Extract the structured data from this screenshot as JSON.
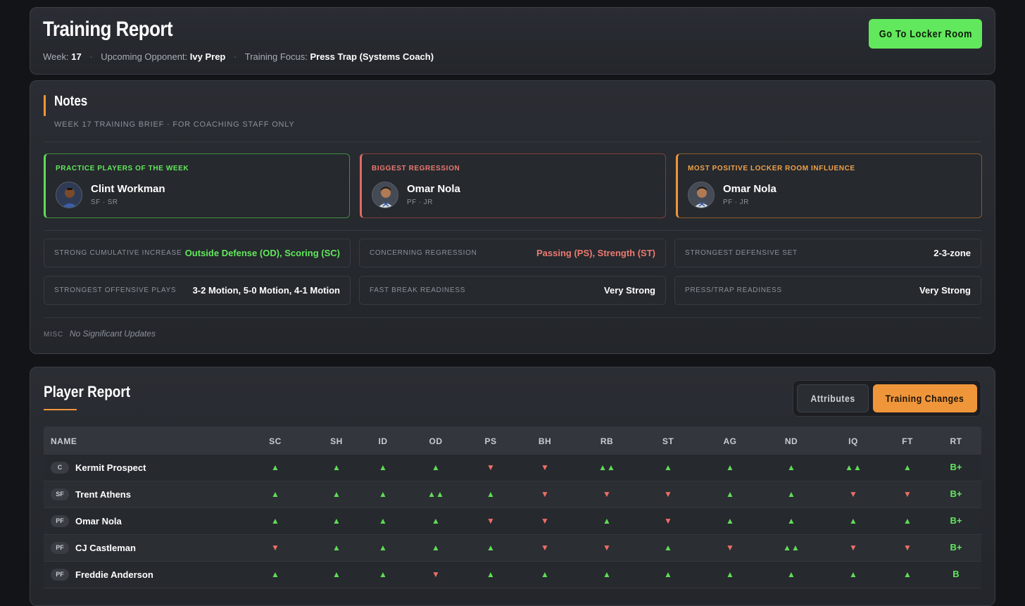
{
  "header": {
    "title": "Training Report",
    "week_label": "Week:",
    "week": "17",
    "opponent_label": "Upcoming Opponent:",
    "opponent": "Ivy Prep",
    "focus_label": "Training Focus:",
    "focus": "Press Trap (Systems Coach)",
    "locker_button": "Go To Locker Room"
  },
  "notes": {
    "title": "Notes",
    "subtitle": "WEEK 17 TRAINING BRIEF · FOR COACHING STAFF ONLY",
    "awards": [
      {
        "label": "PRACTICE PLAYERS OF THE WEEK",
        "name": "Clint Workman",
        "pos": "SF · SR",
        "accent": "#5fdc55"
      },
      {
        "label": "BIGGEST REGRESSION",
        "name": "Omar Nola",
        "pos": "PF · JR",
        "accent": "#e06b63"
      },
      {
        "label": "MOST POSITIVE LOCKER ROOM INFLUENCE",
        "name": "Omar Nola",
        "pos": "PF · JR",
        "accent": "#f0963a"
      }
    ],
    "stats": [
      {
        "label": "STRONG CUMULATIVE INCREASE",
        "value": "Outside Defense (OD), Scoring (SC)"
      },
      {
        "label": "CONCERNING REGRESSION",
        "value": "Passing (PS), Strength (ST)"
      },
      {
        "label": "STRONGEST DEFENSIVE SET",
        "value": "2-3-zone"
      },
      {
        "label": "STRONGEST OFFENSIVE PLAYS",
        "value": "3-2 Motion, 5-0 Motion, 4-1 Motion"
      },
      {
        "label": "FAST BREAK READINESS",
        "value": "Very Strong"
      },
      {
        "label": "PRESS/TRAP READINESS",
        "value": "Very Strong"
      }
    ],
    "misc_label": "MISC",
    "misc_value": "No Significant Updates"
  },
  "report": {
    "title": "Player Report",
    "tab_attributes": "Attributes",
    "tab_training": "Training Changes",
    "columns": [
      "NAME",
      "SC",
      "SH",
      "ID",
      "OD",
      "PS",
      "BH",
      "RB",
      "ST",
      "AG",
      "ND",
      "IQ",
      "FT",
      "RT"
    ],
    "rows": [
      {
        "pos": "C",
        "name": "Kermit Prospect",
        "changes": [
          "▲",
          "▲",
          "▲",
          "▲",
          "▼",
          "▼",
          "▲▲",
          "▲",
          "▲",
          "▲",
          "▲▲",
          "▲"
        ],
        "rt": "B+"
      },
      {
        "pos": "SF",
        "name": "Trent Athens",
        "changes": [
          "▲",
          "▲",
          "▲",
          "▲▲",
          "▲",
          "▼",
          "▼",
          "▼",
          "▲",
          "▲",
          "▼",
          "▼"
        ],
        "rt": "B+"
      },
      {
        "pos": "PF",
        "name": "Omar Nola",
        "changes": [
          "▲",
          "▲",
          "▲",
          "▲",
          "▼",
          "▼",
          "▲",
          "▼",
          "▲",
          "▲",
          "▲",
          "▲"
        ],
        "rt": "B+"
      },
      {
        "pos": "PF",
        "name": "CJ Castleman",
        "changes": [
          "▼",
          "▲",
          "▲",
          "▲",
          "▲",
          "▼",
          "▼",
          "▲",
          "▼",
          "▲▲",
          "▼",
          "▼"
        ],
        "rt": "B+"
      },
      {
        "pos": "PF",
        "name": "Freddie Anderson",
        "changes": [
          "▲",
          "▲",
          "▲",
          "▼",
          "▲",
          "▲",
          "▲",
          "▲",
          "▲",
          "▲",
          "▲",
          "▲"
        ],
        "rt": "B"
      }
    ]
  }
}
